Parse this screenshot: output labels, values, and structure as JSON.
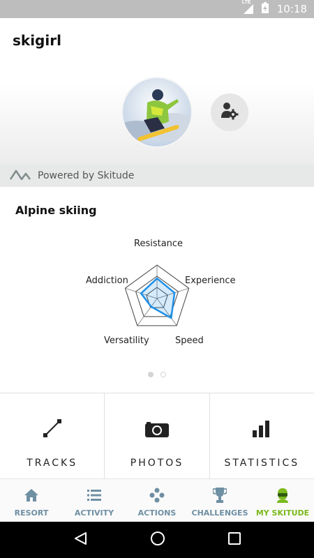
{
  "status": {
    "network": "LTE",
    "time": "10:18"
  },
  "profile": {
    "username": "skigirl"
  },
  "powered_by": "Powered by Skitude",
  "section_title": "Alpine skiing",
  "radar": {
    "labels": {
      "resistance": "Resistance",
      "experience": "Experience",
      "speed": "Speed",
      "versatility": "Versatility",
      "addiction": "Addiction"
    },
    "values": {
      "resistance": 0.6,
      "experience": 0.55,
      "speed": 0.72,
      "versatility": 0.3,
      "addiction": 0.5
    },
    "color": "#1e90e8"
  },
  "pager": {
    "pages": 2,
    "current": 1
  },
  "tiles": [
    {
      "label": "TRACKS",
      "icon": "track-line-icon"
    },
    {
      "label": "PHOTOS",
      "icon": "camera-icon"
    },
    {
      "label": "STATISTICS",
      "icon": "bar-chart-icon"
    }
  ],
  "nav": [
    {
      "label": "RESORT",
      "icon": "home-icon",
      "active": false
    },
    {
      "label": "ACTIVITY",
      "icon": "list-icon",
      "active": false
    },
    {
      "label": "ACTIONS",
      "icon": "dots-cluster-icon",
      "active": false
    },
    {
      "label": "CHALLENGES",
      "icon": "trophy-icon",
      "active": false
    },
    {
      "label": "MY SKITUDE",
      "icon": "skier-helmet-icon",
      "active": true
    }
  ],
  "colors": {
    "nav_inactive": "#6f8fa3",
    "nav_active": "#7bb91d",
    "status_bar": "#bdbdbd"
  }
}
